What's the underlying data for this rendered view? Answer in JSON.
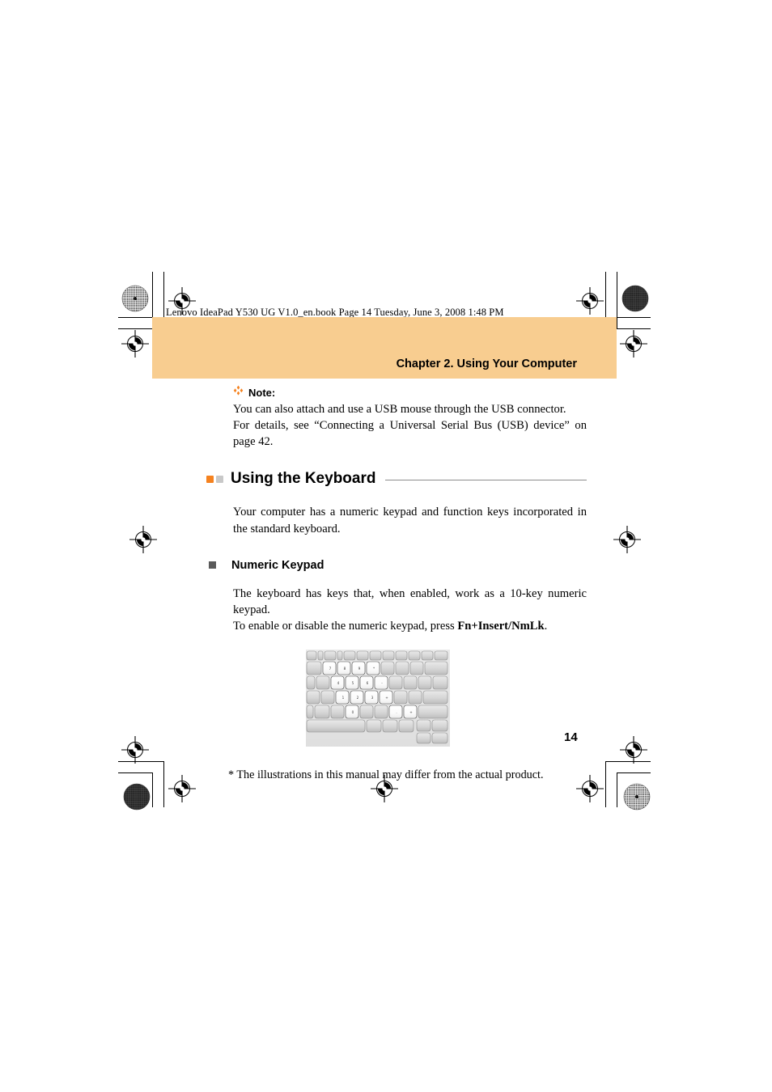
{
  "document": {
    "file_info": "Lenovo IdeaPad Y530 UG V1.0_en.book  Page 14  Tuesday, June 3, 2008  1:48 PM",
    "chapter_header": "Chapter 2. Using Your Computer",
    "page_number": "14"
  },
  "note": {
    "icon": "diamond-cluster-icon",
    "label": "Note:",
    "line1": "You can also attach and use a USB mouse through the USB connector.",
    "line2": "For details, see “Connecting a Universal Serial Bus (USB) device” on",
    "line3": "page 42."
  },
  "section": {
    "title": "Using the Keyboard",
    "bullet_orange": "#F5821F",
    "bullet_gray": "#C8C8C8",
    "intro": "Your computer has a numeric keypad and function keys incorporated in the standard keyboard."
  },
  "subsection": {
    "title": "Numeric Keypad",
    "bullet_color": "#5A5A5A",
    "para1": "The keyboard has keys that, when enabled, work as a 10-key numeric keypad.",
    "para2_prefix": "To enable or disable the numeric keypad, press ",
    "para2_bold": "Fn+Insert/NmLk",
    "para2_suffix": "."
  },
  "figure": {
    "name": "keyboard-illustration",
    "caption": "* The illustrations in this manual may differ from the actual product."
  },
  "colors": {
    "banner": "#F8CD90",
    "accent_orange": "#F5821F",
    "rule": "#8D8D8D",
    "text": "#000000"
  }
}
